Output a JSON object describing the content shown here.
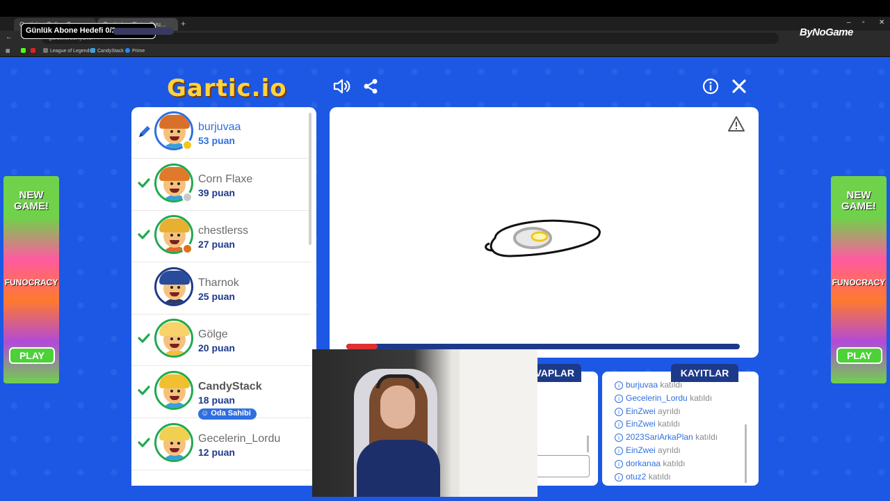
{
  "overlay": {
    "goal_label": "Günlük Abone Hedefi 0/2",
    "brand": "ByNoGame"
  },
  "browser": {
    "tabs": [
      "Garticio - Online Ç...",
      "Gartic.io - Çizim Oyu..."
    ],
    "url": "gartic.io/05Ayc/ro",
    "bookmarks": [
      "League of Legends",
      "CandyStack",
      "Prime"
    ],
    "colors": {
      "chrome": "#1f1f1f"
    }
  },
  "game": {
    "logo": "Gartic.io",
    "ad": {
      "line1": "NEW GAME!",
      "line2": "FUNOCRACY",
      "play_label": "PLAY"
    },
    "players": [
      {
        "name": "burjuvaa",
        "score": "53 puan",
        "mark": "pen",
        "status_color": "#f2c61f",
        "hair": "#d9702a",
        "shirt": "#3aa0d8",
        "role": "drawer"
      },
      {
        "name": "Corn Flaxe",
        "score": "39 puan",
        "mark": "check",
        "status_color": "#c9c9c9",
        "hair": "#e07a2a",
        "shirt": "#3aa0d8",
        "role": ""
      },
      {
        "name": "chestlerss",
        "score": "27 puan",
        "mark": "check",
        "status_color": "#e0701a",
        "hair": "#e8b030",
        "shirt": "#e06a2a",
        "role": ""
      },
      {
        "name": "Tharnok",
        "score": "25 puan",
        "mark": "",
        "status_color": "",
        "hair": "#2a4a9a",
        "shirt": "#2a3a6a",
        "role": ""
      },
      {
        "name": "Gölge",
        "score": "20 puan",
        "mark": "check",
        "status_color": "",
        "hair": "#f7d36a",
        "shirt": "#f0c040",
        "role": ""
      },
      {
        "name": "CandyStack",
        "score": "18 puan",
        "mark": "check",
        "status_color": "",
        "hair": "#f0c030",
        "shirt": "#3aa0d8",
        "role": "owner",
        "badge": "Oda Sahibi"
      },
      {
        "name": "Gecelerin_Lordu",
        "score": "12 puan",
        "mark": "check",
        "status_color": "",
        "hair": "#f0d050",
        "shirt": "#3aa0d8",
        "role": ""
      }
    ],
    "timer_progress": 0.08,
    "tabs": {
      "answers": "CEVAPLAR",
      "answers_visible": "VAPLAR",
      "logs": "KAYITLAR"
    },
    "logs": [
      {
        "user": "burjuvaa",
        "action": "katıldı"
      },
      {
        "user": "Gecelerin_Lordu",
        "action": "katıldı"
      },
      {
        "user": "EinZwei",
        "action": "ayrıldı"
      },
      {
        "user": "EinZwei",
        "action": "katıldı"
      },
      {
        "user": "2023SariArkaPlan",
        "action": "katıldı"
      },
      {
        "user": "EinZwei",
        "action": "ayrıldı"
      },
      {
        "user": "dorkanaa",
        "action": "katıldı"
      },
      {
        "user": "otuz2",
        "action": "katıldı"
      }
    ],
    "icons": [
      "speaker-icon",
      "share-icon",
      "info-icon",
      "close-icon",
      "warning-icon",
      "pencil-icon",
      "check-icon"
    ]
  }
}
